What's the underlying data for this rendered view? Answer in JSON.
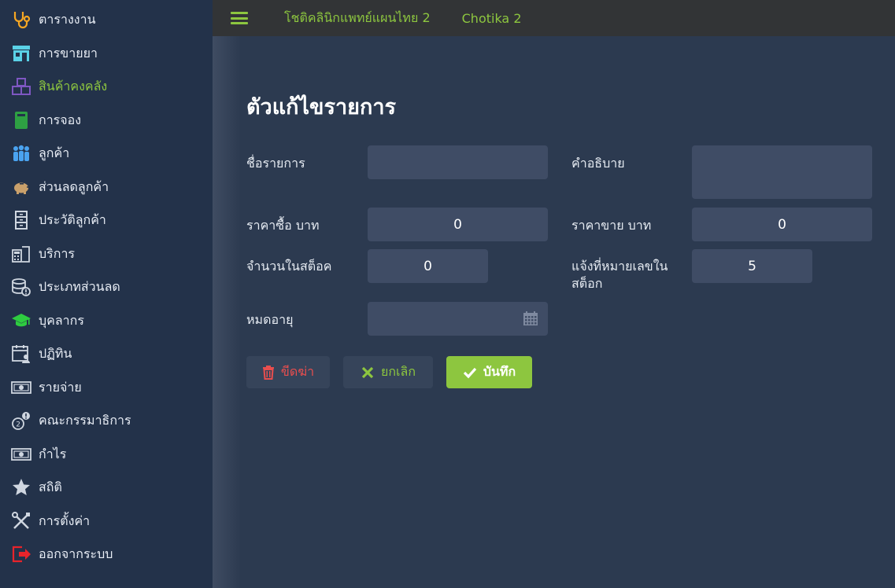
{
  "sidebar": {
    "items": [
      {
        "label": "ตารางงาน",
        "icon": "stethoscope-icon"
      },
      {
        "label": "การขายยา",
        "icon": "store-icon"
      },
      {
        "label": "สินค้าคงคลัง",
        "icon": "boxes-icon"
      },
      {
        "label": "การจอง",
        "icon": "book-icon"
      },
      {
        "label": "ลูกค้า",
        "icon": "users-icon"
      },
      {
        "label": "ส่วนลดลูกค้า",
        "icon": "piggy-bank-icon"
      },
      {
        "label": "ประวัติลูกค้า",
        "icon": "file-cabinet-icon"
      },
      {
        "label": "บริการ",
        "icon": "calculator-book-icon"
      },
      {
        "label": "ประเภทส่วนลด",
        "icon": "coins-icon"
      },
      {
        "label": "บุคลากร",
        "icon": "graduation-cap-icon"
      },
      {
        "label": "ปฏิทิน",
        "icon": "calendar-user-icon"
      },
      {
        "label": "รายจ่าย",
        "icon": "money-icon"
      },
      {
        "label": "คณะกรรมาธิการ",
        "icon": "commission-icon"
      },
      {
        "label": "กำไร",
        "icon": "money-icon"
      },
      {
        "label": "สถิติ",
        "icon": "star-icon"
      },
      {
        "label": "การตั้งค่า",
        "icon": "tools-icon"
      },
      {
        "label": "ออกจากระบบ",
        "icon": "logout-icon"
      }
    ],
    "active_index": 2
  },
  "topbar": {
    "clinic_name": "โชติคลินิกแพทย์แผนไทย 2",
    "user_name": "Chotika 2"
  },
  "form": {
    "title": "ตัวแก้ไขรายการ",
    "name_label": "ชื่อรายการ",
    "name_value": "",
    "description_label": "คำอธิบาย",
    "description_value": "",
    "buy_price_label": "ราคาซื้อ บาท",
    "buy_price_value": "0",
    "sell_price_label": "ราคาขาย บาท",
    "sell_price_value": "0",
    "stock_label": "จำนวนในสต็อค",
    "stock_value": "0",
    "notify_label": "แจ้งที่หมายเลขในสต็อก",
    "notify_value": "5",
    "expiry_label": "หมดอายุ",
    "expiry_value": ""
  },
  "buttons": {
    "delete_label": "ขีดฆ่า",
    "cancel_label": "ยกเลิก",
    "save_label": "บันทึก"
  },
  "colors": {
    "accent": "#8dc63f",
    "danger": "#e84e4e",
    "sidebar_bg": "#23324a",
    "main_bg": "#2c3a50",
    "topbar_bg": "#323436"
  }
}
